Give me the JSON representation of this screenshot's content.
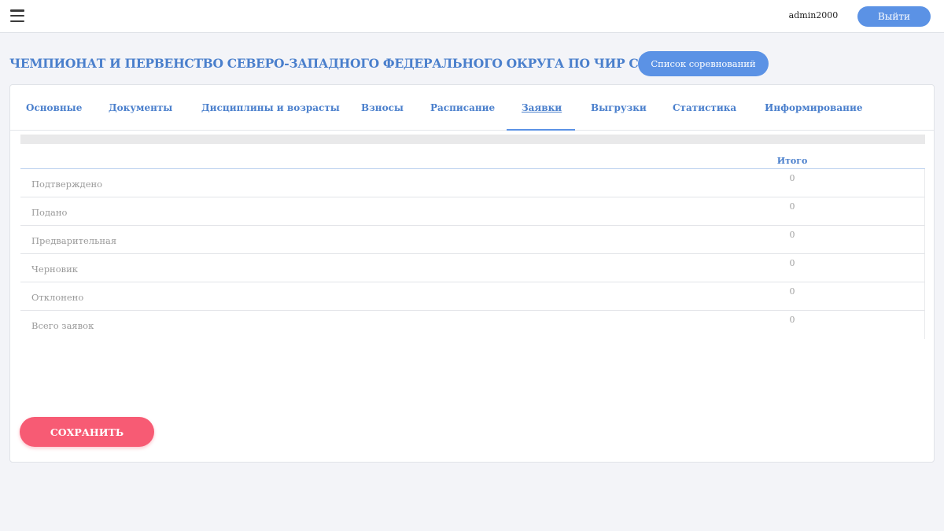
{
  "header": {
    "username": "admin2000",
    "logout_label": "Выйти"
  },
  "page": {
    "title": "ЧЕМПИОНАТ И ПЕРВЕНСТВО СЕВЕРО-ЗАПАДНОГО ФЕДЕРАЛЬНОГО ОКРУГА ПО ЧИР СПОРТУ",
    "competitions_list_label": "Список соревнований"
  },
  "tabs": [
    {
      "label": "Основные"
    },
    {
      "label": "Документы"
    },
    {
      "label": "Дисциплины и возрасты"
    },
    {
      "label": "Взносы"
    },
    {
      "label": "Расписание"
    },
    {
      "label": "Заявки",
      "active": true
    },
    {
      "label": "Выгрузки"
    },
    {
      "label": "Статистика"
    },
    {
      "label": "Информирование"
    }
  ],
  "table": {
    "total_header": "Итого",
    "rows": [
      {
        "label": "Подтверждено",
        "value": "0"
      },
      {
        "label": "Подано",
        "value": "0"
      },
      {
        "label": "Предварительная",
        "value": "0"
      },
      {
        "label": "Черновик",
        "value": "0"
      },
      {
        "label": "Отклонено",
        "value": "0"
      },
      {
        "label": "Всего заявок",
        "value": "0"
      }
    ]
  },
  "actions": {
    "save_label": "СОХРАНИТЬ"
  },
  "colors": {
    "accent": "#5b92e5",
    "title": "#4a7fcc",
    "save": "#f75b74",
    "background": "#f3f4f8"
  }
}
